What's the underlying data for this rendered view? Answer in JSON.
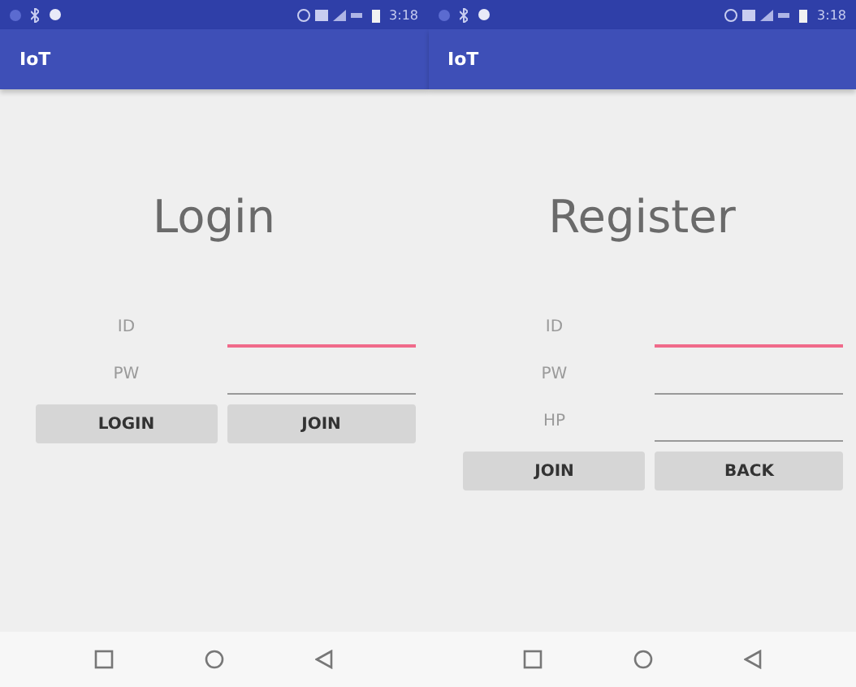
{
  "screens": [
    {
      "app_bar": {
        "title": "IoT"
      },
      "status_bar": {
        "time": "3:18"
      },
      "heading": "Login",
      "fields": [
        {
          "label": "ID",
          "focused": true
        },
        {
          "label": "PW",
          "focused": false
        }
      ],
      "buttons": [
        "LOGIN",
        "JOIN"
      ]
    },
    {
      "app_bar": {
        "title": "IoT"
      },
      "status_bar": {
        "time": "3:18"
      },
      "heading": "Register",
      "fields": [
        {
          "label": "ID",
          "focused": true
        },
        {
          "label": "PW",
          "focused": false
        },
        {
          "label": "HP",
          "focused": false
        }
      ],
      "buttons": [
        "JOIN",
        "BACK"
      ]
    }
  ]
}
